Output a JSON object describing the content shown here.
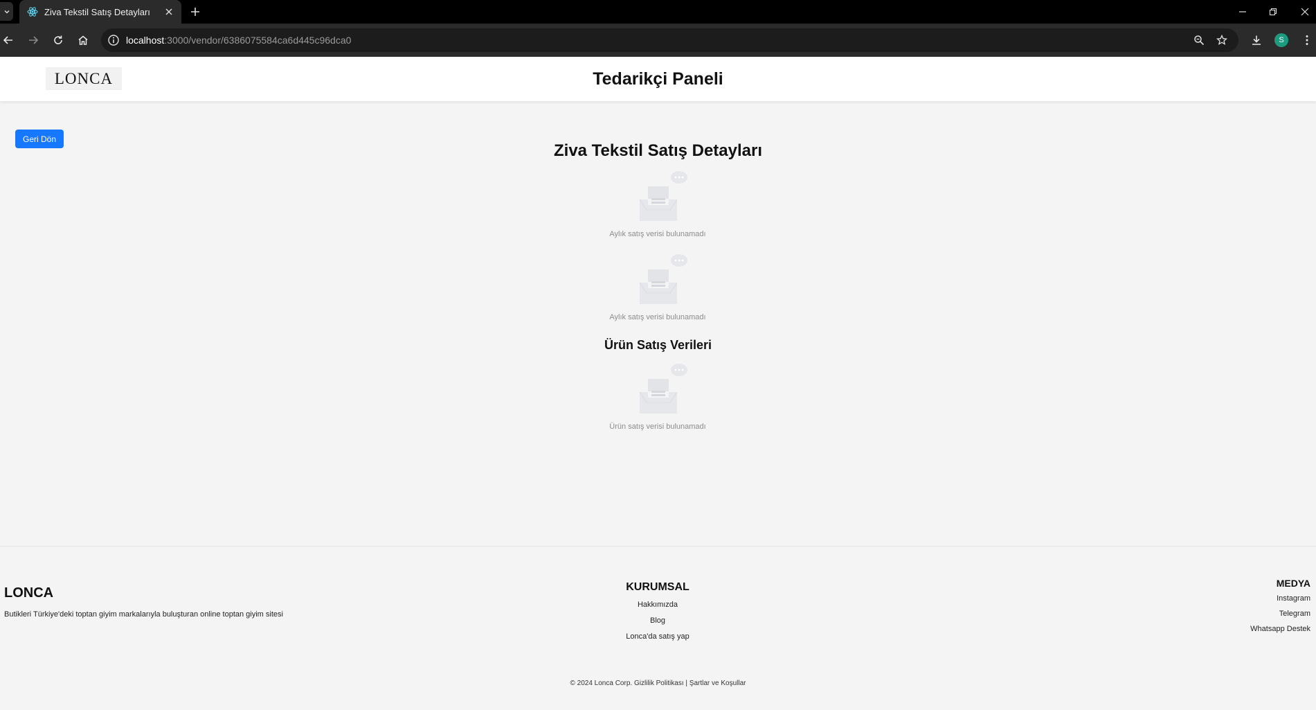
{
  "browser": {
    "tab_title": "Ziva Tekstil Satış Detayları",
    "url_host": "localhost",
    "url_path": ":3000/vendor/6386075584ca6d445c96dca0",
    "profile_initial": "S"
  },
  "header": {
    "logo": "LONCA",
    "title": "Tedarikçi Paneli"
  },
  "main": {
    "back_label": "Geri Dön",
    "vendor_title": "Ziva Tekstil Satış Detayları",
    "empty_monthly_1": "Aylık satış verisi bulunamadı",
    "empty_monthly_2": "Aylık satış verisi bulunamadı",
    "product_section_title": "Ürün Satış Verileri",
    "empty_product": "Ürün satış verisi bulunamadı"
  },
  "footer": {
    "brand": "LONCA",
    "description": "Butikleri Türkiye'deki toptan giyim markalarıyla buluşturan online toptan giyim sitesi",
    "corporate_heading": "KURUMSAL",
    "corporate_links": [
      "Hakkımızda",
      "Blog",
      "Lonca'da satış yap"
    ],
    "media_heading": "MEDYA",
    "media_links": [
      "Instagram",
      "Telegram",
      "Whatsapp Destek"
    ],
    "copyright": "© 2024 Lonca Corp. Gizlilik Politikası | Şartlar ve Koşullar"
  },
  "colors": {
    "primary_button": "#1677ff",
    "page_background": "#f4f4f5",
    "header_background": "#ffffff"
  }
}
